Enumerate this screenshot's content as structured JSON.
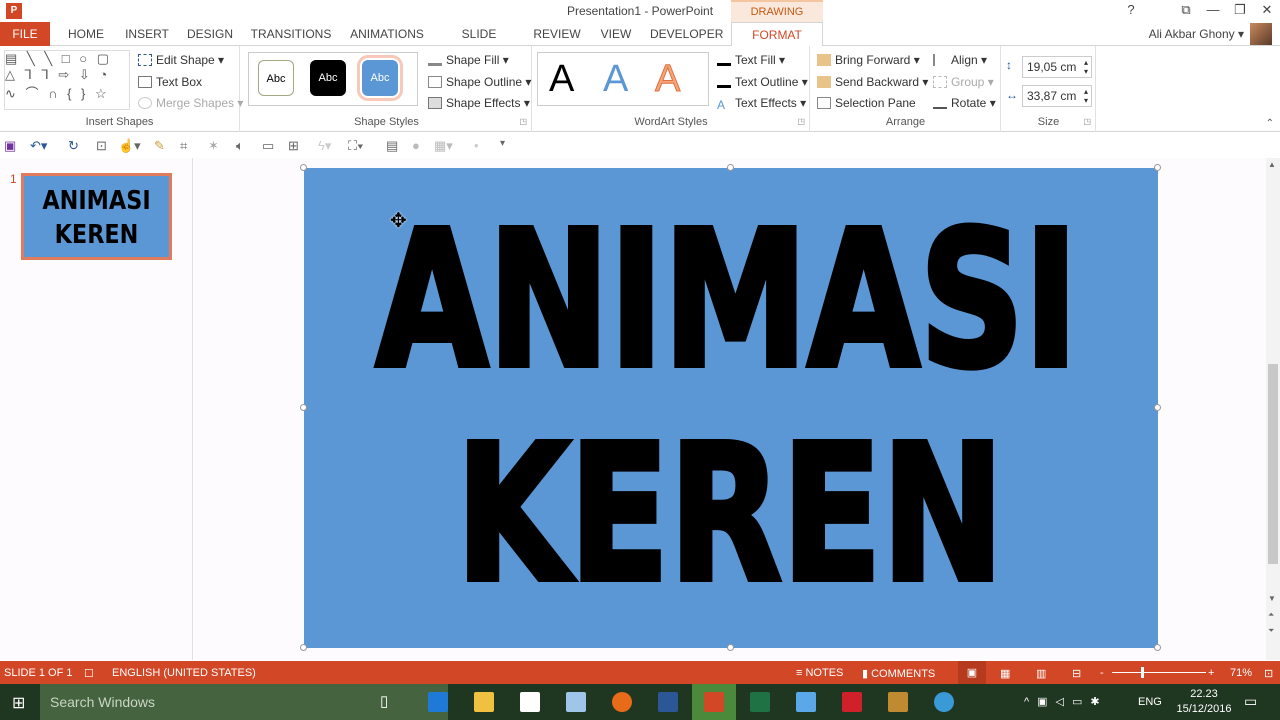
{
  "window": {
    "title": "Presentation1 - PowerPoint",
    "help": "?",
    "ribbon_display": "⧉",
    "minimize": "—",
    "restore": "❐",
    "close": "✕"
  },
  "contextual_tab": "DRAWING TOOLS",
  "tabs": [
    "FILE",
    "HOME",
    "INSERT",
    "DESIGN",
    "TRANSITIONS",
    "ANIMATIONS",
    "SLIDE SHOW",
    "REVIEW",
    "VIEW",
    "DEVELOPER",
    "FORMAT"
  ],
  "active_tab": "FORMAT",
  "user": {
    "name": "Ali Akbar Ghony"
  },
  "ribbon": {
    "insert_shapes": {
      "label": "Insert Shapes",
      "edit_shape": "Edit Shape",
      "text_box": "Text Box",
      "merge_shapes": "Merge Shapes",
      "shapes_row1": "▤ ╲ ╲ □ ○ ▢",
      "shapes_row2": "△ ⅂ ⅂ ⇨ ⇩ ◔",
      "shapes_row3": "∿ ⌒ ∩ { } ☆"
    },
    "shape_styles": {
      "label": "Shape Styles",
      "presets": [
        "Abc",
        "Abc",
        "Abc"
      ],
      "shape_fill": "Shape Fill",
      "shape_outline": "Shape Outline",
      "shape_effects": "Shape Effects"
    },
    "wordart_styles": {
      "label": "WordArt Styles",
      "presets": [
        "A",
        "A",
        "A"
      ],
      "text_fill": "Text Fill",
      "text_outline": "Text Outline",
      "text_effects": "Text Effects"
    },
    "arrange": {
      "label": "Arrange",
      "bring_forward": "Bring Forward",
      "send_backward": "Send Backward",
      "selection_pane": "Selection Pane",
      "align": "Align",
      "group": "Group",
      "rotate": "Rotate"
    },
    "size": {
      "label": "Size",
      "height": "19,05 cm",
      "width": "33,87 cm"
    }
  },
  "slides": [
    {
      "number": "1",
      "line1": "ANIMASI",
      "line2": "KEREN"
    }
  ],
  "slide": {
    "line1": "ANIMASI",
    "line2": "KEREN",
    "background": "#5b97d5"
  },
  "status": {
    "slide": "SLIDE 1 OF 1",
    "language": "ENGLISH (UNITED STATES)",
    "notes": "NOTES",
    "comments": "COMMENTS",
    "zoom": "71%",
    "zoom_level": 0.71
  },
  "taskbar": {
    "search_placeholder": "Search Windows",
    "lang": "ENG",
    "time": "22.23",
    "date": "15/12/2016"
  },
  "colors": {
    "accent": "#d24726",
    "slide_bg": "#5b97d5"
  }
}
